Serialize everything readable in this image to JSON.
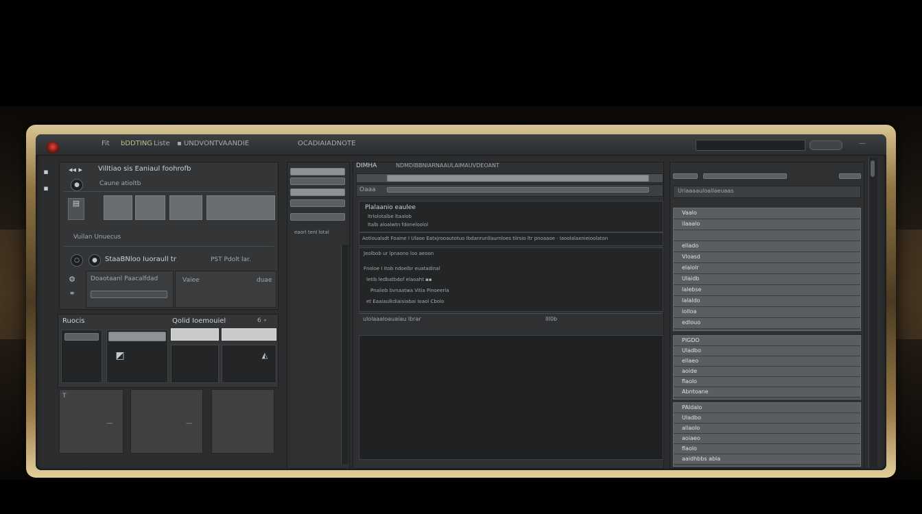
{
  "titlebar": {
    "items": [
      "Fit",
      "bDDTING",
      "Liste",
      "▪ UNDVONTVAANDIE",
      "OCADIAIADNOTE"
    ],
    "close": "—"
  },
  "left": {
    "header": "Villtiao sis Eaniaul foohrofb",
    "subheader": "Caune atioltb",
    "caption": "Vuilan Unuecus",
    "row_label": "StaaBNloo Iuoraull tr",
    "row_value": "PST Pdolt lar.",
    "field1_label": "Doaotaanl Paacalfdad",
    "field2_label": "Vaiee",
    "field2_suffix": "duae"
  },
  "lower_left": {
    "title": "Ruocis",
    "title2": "Qolid Ioemouiel",
    "title2_suffix": "6 ∘"
  },
  "center_col": {
    "caption": "eaorl tenl lotal"
  },
  "main": {
    "tab1": "DIMHA",
    "tab2": "NDMDIBBNIARNAAULAIMAUVDEOANT",
    "address": "Oaaa",
    "block_title": "Plalaanio eaulee",
    "line1": "ltrlolotalbe    ltaalob",
    "line2": "ltalb  aloalwtn fdoneloolol",
    "wide_line": "Aotioualsdt  Foaine  I Ulaoe Eatxjrooautotuo  Ibdanrunllaurnloes  tiirsio  ltr  pnoaaoe  · Iaoolalaxnieioolaton",
    "code1": "Jeolbob  ur  lpnaono loo     aeoon",
    "code2": "Fnoloe          I  Itob ndoelbr  euatadinal",
    "code3": "letib ledbatbdof  elaoaht  ▪▪",
    "code4": "Pnaiieb bvnaatwa  Vitia    Pinoeerla",
    "code5": "et  Eaaiaulkdiaisiabai  Ioaol Cbolo",
    "footer_left": "ulolaaaloauaiau lbrar",
    "footer_right": "III0b"
  },
  "right": {
    "title": "Uriaaaauloallaeuaas",
    "group1": [
      "Vaalo",
      "ilaaalo",
      "",
      "ellado",
      "Vloasd",
      "elalolr",
      "Ulaidb",
      "lalebse",
      "lalaldo",
      "lolloa",
      "edlouo"
    ],
    "group2": [
      "PlGDO",
      "Uladbo",
      "ellaeo",
      "aoide",
      "flaolo",
      "Abntoane"
    ],
    "group3": [
      "PAIdalo",
      "Uladbo",
      "allaolo",
      "aoiaeo",
      "flaolo",
      "aaidhbbs  abla"
    ]
  },
  "icons": {
    "record": "record-button-icon",
    "folder": "folder-icon",
    "gear": "gear-icon"
  }
}
